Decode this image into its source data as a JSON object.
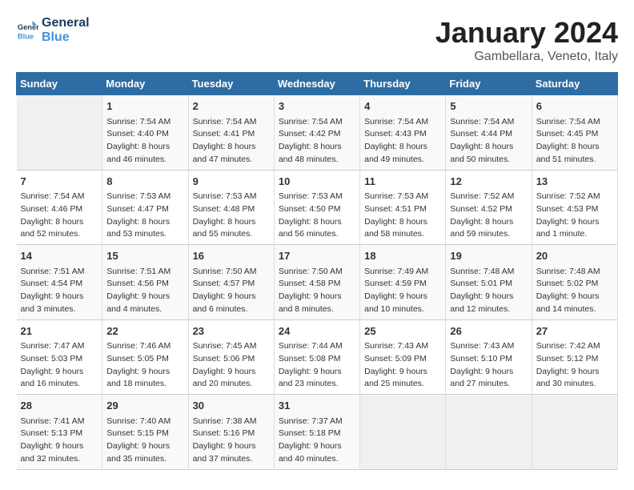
{
  "header": {
    "logo_line1": "General",
    "logo_line2": "Blue",
    "month": "January 2024",
    "location": "Gambellara, Veneto, Italy"
  },
  "days_of_week": [
    "Sunday",
    "Monday",
    "Tuesday",
    "Wednesday",
    "Thursday",
    "Friday",
    "Saturday"
  ],
  "weeks": [
    [
      {
        "day": null,
        "num": null,
        "info": null
      },
      {
        "day": 1,
        "num": "1",
        "info": "Sunrise: 7:54 AM\nSunset: 4:40 PM\nDaylight: 8 hours\nand 46 minutes."
      },
      {
        "day": 2,
        "num": "2",
        "info": "Sunrise: 7:54 AM\nSunset: 4:41 PM\nDaylight: 8 hours\nand 47 minutes."
      },
      {
        "day": 3,
        "num": "3",
        "info": "Sunrise: 7:54 AM\nSunset: 4:42 PM\nDaylight: 8 hours\nand 48 minutes."
      },
      {
        "day": 4,
        "num": "4",
        "info": "Sunrise: 7:54 AM\nSunset: 4:43 PM\nDaylight: 8 hours\nand 49 minutes."
      },
      {
        "day": 5,
        "num": "5",
        "info": "Sunrise: 7:54 AM\nSunset: 4:44 PM\nDaylight: 8 hours\nand 50 minutes."
      },
      {
        "day": 6,
        "num": "6",
        "info": "Sunrise: 7:54 AM\nSunset: 4:45 PM\nDaylight: 8 hours\nand 51 minutes."
      }
    ],
    [
      {
        "day": 7,
        "num": "7",
        "info": "Sunrise: 7:54 AM\nSunset: 4:46 PM\nDaylight: 8 hours\nand 52 minutes."
      },
      {
        "day": 8,
        "num": "8",
        "info": "Sunrise: 7:53 AM\nSunset: 4:47 PM\nDaylight: 8 hours\nand 53 minutes."
      },
      {
        "day": 9,
        "num": "9",
        "info": "Sunrise: 7:53 AM\nSunset: 4:48 PM\nDaylight: 8 hours\nand 55 minutes."
      },
      {
        "day": 10,
        "num": "10",
        "info": "Sunrise: 7:53 AM\nSunset: 4:50 PM\nDaylight: 8 hours\nand 56 minutes."
      },
      {
        "day": 11,
        "num": "11",
        "info": "Sunrise: 7:53 AM\nSunset: 4:51 PM\nDaylight: 8 hours\nand 58 minutes."
      },
      {
        "day": 12,
        "num": "12",
        "info": "Sunrise: 7:52 AM\nSunset: 4:52 PM\nDaylight: 8 hours\nand 59 minutes."
      },
      {
        "day": 13,
        "num": "13",
        "info": "Sunrise: 7:52 AM\nSunset: 4:53 PM\nDaylight: 9 hours\nand 1 minute."
      }
    ],
    [
      {
        "day": 14,
        "num": "14",
        "info": "Sunrise: 7:51 AM\nSunset: 4:54 PM\nDaylight: 9 hours\nand 3 minutes."
      },
      {
        "day": 15,
        "num": "15",
        "info": "Sunrise: 7:51 AM\nSunset: 4:56 PM\nDaylight: 9 hours\nand 4 minutes."
      },
      {
        "day": 16,
        "num": "16",
        "info": "Sunrise: 7:50 AM\nSunset: 4:57 PM\nDaylight: 9 hours\nand 6 minutes."
      },
      {
        "day": 17,
        "num": "17",
        "info": "Sunrise: 7:50 AM\nSunset: 4:58 PM\nDaylight: 9 hours\nand 8 minutes."
      },
      {
        "day": 18,
        "num": "18",
        "info": "Sunrise: 7:49 AM\nSunset: 4:59 PM\nDaylight: 9 hours\nand 10 minutes."
      },
      {
        "day": 19,
        "num": "19",
        "info": "Sunrise: 7:48 AM\nSunset: 5:01 PM\nDaylight: 9 hours\nand 12 minutes."
      },
      {
        "day": 20,
        "num": "20",
        "info": "Sunrise: 7:48 AM\nSunset: 5:02 PM\nDaylight: 9 hours\nand 14 minutes."
      }
    ],
    [
      {
        "day": 21,
        "num": "21",
        "info": "Sunrise: 7:47 AM\nSunset: 5:03 PM\nDaylight: 9 hours\nand 16 minutes."
      },
      {
        "day": 22,
        "num": "22",
        "info": "Sunrise: 7:46 AM\nSunset: 5:05 PM\nDaylight: 9 hours\nand 18 minutes."
      },
      {
        "day": 23,
        "num": "23",
        "info": "Sunrise: 7:45 AM\nSunset: 5:06 PM\nDaylight: 9 hours\nand 20 minutes."
      },
      {
        "day": 24,
        "num": "24",
        "info": "Sunrise: 7:44 AM\nSunset: 5:08 PM\nDaylight: 9 hours\nand 23 minutes."
      },
      {
        "day": 25,
        "num": "25",
        "info": "Sunrise: 7:43 AM\nSunset: 5:09 PM\nDaylight: 9 hours\nand 25 minutes."
      },
      {
        "day": 26,
        "num": "26",
        "info": "Sunrise: 7:43 AM\nSunset: 5:10 PM\nDaylight: 9 hours\nand 27 minutes."
      },
      {
        "day": 27,
        "num": "27",
        "info": "Sunrise: 7:42 AM\nSunset: 5:12 PM\nDaylight: 9 hours\nand 30 minutes."
      }
    ],
    [
      {
        "day": 28,
        "num": "28",
        "info": "Sunrise: 7:41 AM\nSunset: 5:13 PM\nDaylight: 9 hours\nand 32 minutes."
      },
      {
        "day": 29,
        "num": "29",
        "info": "Sunrise: 7:40 AM\nSunset: 5:15 PM\nDaylight: 9 hours\nand 35 minutes."
      },
      {
        "day": 30,
        "num": "30",
        "info": "Sunrise: 7:38 AM\nSunset: 5:16 PM\nDaylight: 9 hours\nand 37 minutes."
      },
      {
        "day": 31,
        "num": "31",
        "info": "Sunrise: 7:37 AM\nSunset: 5:18 PM\nDaylight: 9 hours\nand 40 minutes."
      },
      {
        "day": null,
        "num": null,
        "info": null
      },
      {
        "day": null,
        "num": null,
        "info": null
      },
      {
        "day": null,
        "num": null,
        "info": null
      }
    ]
  ]
}
